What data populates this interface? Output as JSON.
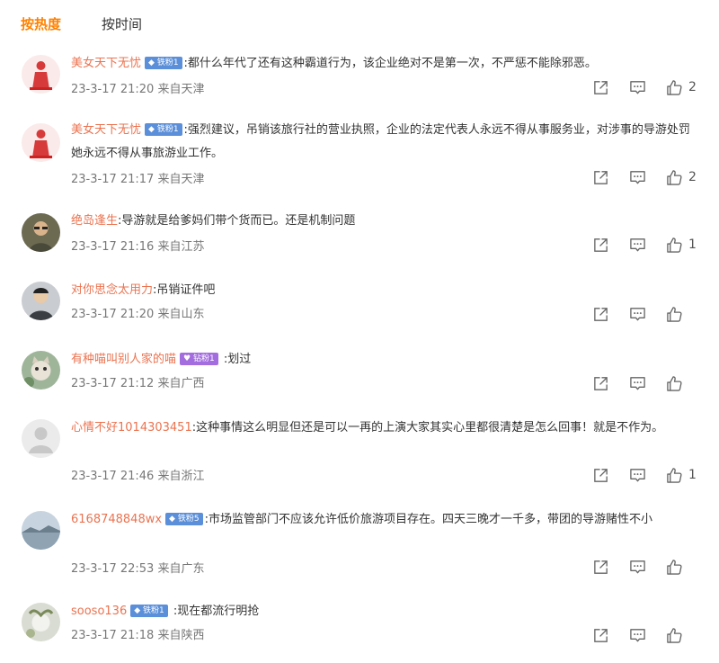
{
  "tabs": {
    "hot": "按热度",
    "time": "按时间"
  },
  "comments": [
    {
      "username": "美女天下无忧",
      "badge": "铁粉1",
      "text": ":都什么年代了还有这种霸道行为，该企业绝对不是第一次，不严惩不能除邪恶。",
      "time": "23-3-17 21:20",
      "location": "来自天津",
      "likes": "2"
    },
    {
      "username": "美女天下无忧",
      "badge": "铁粉1",
      "text": ":强烈建议，吊销该旅行社的营业执照，企业的法定代表人永远不得从事服务业，对涉事的导游处罚她永远不得从事旅游业工作。",
      "time": "23-3-17 21:17",
      "location": "来自天津",
      "likes": "2"
    },
    {
      "username": "绝岛逢生",
      "badge": "",
      "text": ":导游就是给爹妈们带个货而已。还是机制问题",
      "time": "23-3-17 21:16",
      "location": "来自江苏",
      "likes": "1"
    },
    {
      "username": "对你思念太用力",
      "badge": "",
      "text": ":吊销证件吧",
      "time": "23-3-17 21:20",
      "location": "来自山东",
      "likes": ""
    },
    {
      "username": "有种喵叫别人家的喵",
      "badge": "钻粉1",
      "text": " :划过",
      "time": "23-3-17 21:12",
      "location": "来自广西",
      "likes": ""
    },
    {
      "username": "心情不好1014303451",
      "badge": "",
      "text": ":这种事情这么明显但还是可以一再的上演大家其实心里都很清楚是怎么回事！就是不作为。",
      "time": "23-3-17 21:46",
      "location": "来自浙江",
      "likes": "1"
    },
    {
      "username": "6168748848wx",
      "badge": "铁粉5",
      "text": ":市场监管部门不应该允许低价旅游项目存在。四天三晚才一千多，带团的导游赌性不小",
      "time": "23-3-17 22:53",
      "location": "来自广东",
      "likes": ""
    },
    {
      "username": "sooso136",
      "badge": "铁粉1",
      "text": " :现在都流行明抢",
      "time": "23-3-17 21:18",
      "location": "来自陕西",
      "likes": ""
    }
  ],
  "colors": {
    "accent": "#ff8200",
    "username": "#eb7350",
    "badge_blue": "#5b8fd9",
    "badge_purple": "#a46ddf"
  },
  "icons": {
    "share": "share-icon",
    "reply": "comment-icon",
    "like": "thumbs-up-icon"
  }
}
